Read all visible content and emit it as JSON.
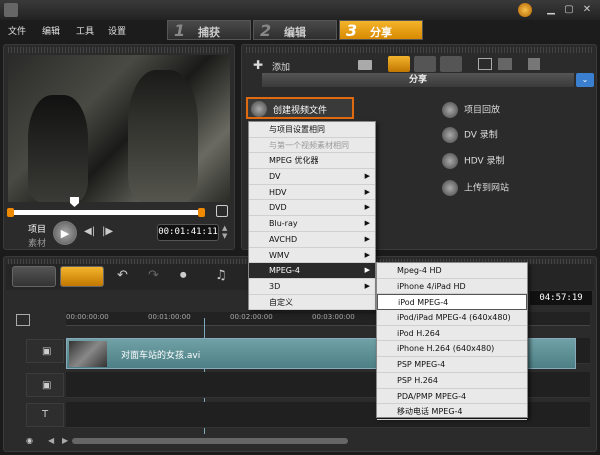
{
  "menu": [
    "文件",
    "编辑",
    "工具",
    "设置"
  ],
  "steps": [
    {
      "num": "1",
      "label": "捕获"
    },
    {
      "num": "2",
      "label": "编辑"
    },
    {
      "num": "3",
      "label": "分享"
    }
  ],
  "preview": {
    "project_label": "项目",
    "clip_label": "素材",
    "timecode": "00:01:41:11"
  },
  "options": {
    "add_label": "添加",
    "share_title": "分享",
    "create_video": "创建视频文件",
    "project_playback": "项目回放",
    "dv_record": "DV 录制",
    "hdv_record": "HDV 录制",
    "upload_web": "上传到网站"
  },
  "context_menu": [
    {
      "label": "与项目设置相同",
      "enabled": true,
      "sub": false
    },
    {
      "label": "与第一个视频素材相同",
      "enabled": false,
      "sub": false
    },
    {
      "label": "MPEG 优化器",
      "enabled": true,
      "sub": false
    },
    {
      "label": "DV",
      "enabled": true,
      "sub": true
    },
    {
      "label": "HDV",
      "enabled": true,
      "sub": true
    },
    {
      "label": "DVD",
      "enabled": true,
      "sub": true
    },
    {
      "label": "Blu-ray",
      "enabled": true,
      "sub": true
    },
    {
      "label": "AVCHD",
      "enabled": true,
      "sub": true
    },
    {
      "label": "WMV",
      "enabled": true,
      "sub": true
    },
    {
      "label": "MPEG-4",
      "enabled": true,
      "sub": true,
      "highlight": true
    },
    {
      "label": "3D",
      "enabled": true,
      "sub": true
    },
    {
      "label": "自定义",
      "enabled": true,
      "sub": false
    }
  ],
  "submenu": [
    {
      "label": "Mpeg-4 HD"
    },
    {
      "label": "iPhone 4/iPad HD"
    },
    {
      "label": "iPod MPEG-4",
      "selected": true
    },
    {
      "label": "iPod/iPad MPEG-4 (640x480)"
    },
    {
      "label": "iPod H.264"
    },
    {
      "label": "iPhone H.264 (640x480)"
    },
    {
      "label": "PSP MPEG-4"
    },
    {
      "label": "PSP H.264"
    },
    {
      "label": "PDA/PMP MPEG-4"
    },
    {
      "label": "移动电话 MPEG-4"
    }
  ],
  "timeline": {
    "ruler": [
      "00:00:00:00",
      "00:01:00:00",
      "00:02:00:00",
      "00:03:00:00"
    ],
    "clip_name": "对面车站的女孩.avi",
    "time_readout": "04:57:19"
  }
}
